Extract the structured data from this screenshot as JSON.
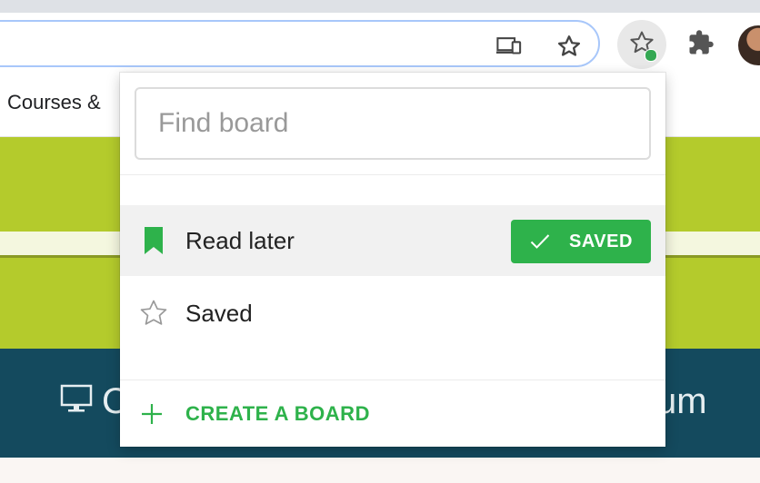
{
  "browser": {
    "icons": {
      "omnibox_cast": "device-cast-icon",
      "omnibox_star": "bookmark-star-icon",
      "extension_star": "extension-star-icon",
      "extension_puzzle": "extensions-puzzle-icon",
      "profile": "profile-avatar"
    },
    "bookmarks_bar": {
      "first_item": "Courses &"
    }
  },
  "page_behind": {
    "teal_left_text": "C",
    "teal_right_text": "um",
    "icons": {
      "monitor": "monitor-icon"
    }
  },
  "popup": {
    "search": {
      "placeholder": "Find board",
      "value": ""
    },
    "boards": [
      {
        "label": "Read later",
        "icon": "bookmark-ribbon-icon",
        "selected": true,
        "badge": "SAVED",
        "badge_icon": "checkmark-icon"
      },
      {
        "label": "Saved",
        "icon": "star-outline-icon",
        "selected": false
      }
    ],
    "create_board": {
      "label": "CREATE A BOARD",
      "icon": "plus-icon"
    }
  },
  "colors": {
    "accent_green": "#2eb24b",
    "omnibox_focus": "#a8c7fa",
    "page_lime": "#b4cb2c",
    "page_teal": "#144a5e"
  }
}
